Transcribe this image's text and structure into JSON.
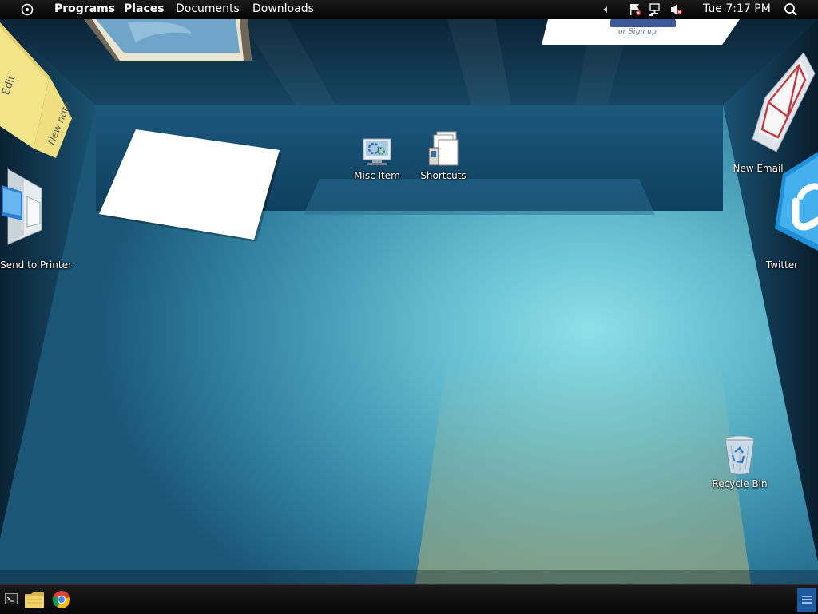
{
  "menubar": {
    "items": [
      "Programs",
      "Places",
      "Documents",
      "Downloads"
    ],
    "clock": "Tue 7:17 PM"
  },
  "wall_items": {
    "note_large_text": "Edit",
    "note_small_text": "New note",
    "login_card_text": "or Sign up"
  },
  "desktop": {
    "misc_item": "Misc Item",
    "shortcuts": "Shortcuts",
    "send_to_printer": "Send to Printer",
    "new_email": "New Email",
    "twitter": "Twitter",
    "recycle_bin": "Recycle Bin"
  },
  "taskbar": {
    "apps": [
      "terminal-icon",
      "file-manager-icon",
      "chrome-icon"
    ]
  },
  "colors": {
    "topbar": "#0a0a0a",
    "room_floor": "#5fb8cc",
    "room_wall": "#0f3a58",
    "twitter_blue": "#1f8fd8",
    "email_red": "#c8343c"
  }
}
